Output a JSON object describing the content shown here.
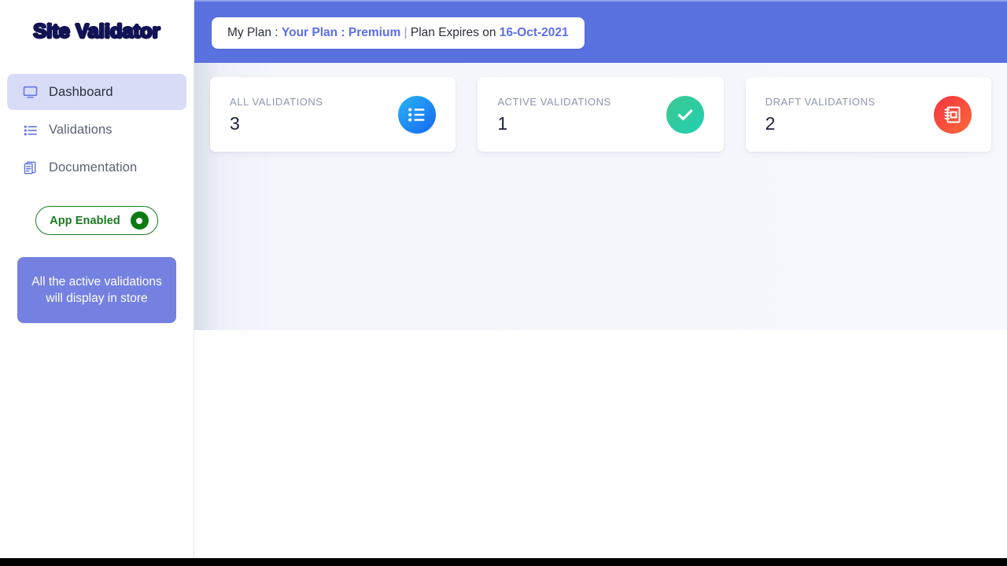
{
  "brand": {
    "name": "Site Validator"
  },
  "sidebar": {
    "items": [
      {
        "label": "Dashboard",
        "icon": "monitor-icon",
        "active": true
      },
      {
        "label": "Validations",
        "icon": "list-icon",
        "active": false
      },
      {
        "label": "Documentation",
        "icon": "document-icon",
        "active": false
      }
    ],
    "toggle": {
      "label": "App Enabled",
      "state": "on",
      "color": "#1d7a21"
    },
    "notice": {
      "text": "All the active validations will display in store",
      "color": "#7481e0"
    }
  },
  "header": {
    "background_color": "#5a72e0",
    "plan": {
      "prefix": "My Plan : ",
      "plan_text": "Your Plan : Premium",
      "separator": " | ",
      "expires_prefix": "Plan Expires on ",
      "expires_date": "16-Oct-2021",
      "accent_color": "#5c6fe8"
    }
  },
  "main": {
    "cards": [
      {
        "label": "ALL VALIDATIONS",
        "value": "3",
        "icon": "list-icon",
        "color": "#1565f0"
      },
      {
        "label": "ACTIVE VALIDATIONS",
        "value": "1",
        "icon": "check-icon",
        "color": "#21cfb3"
      },
      {
        "label": "DRAFT VALIDATIONS",
        "value": "2",
        "icon": "notebook-icon",
        "color": "#f4333d"
      }
    ]
  }
}
